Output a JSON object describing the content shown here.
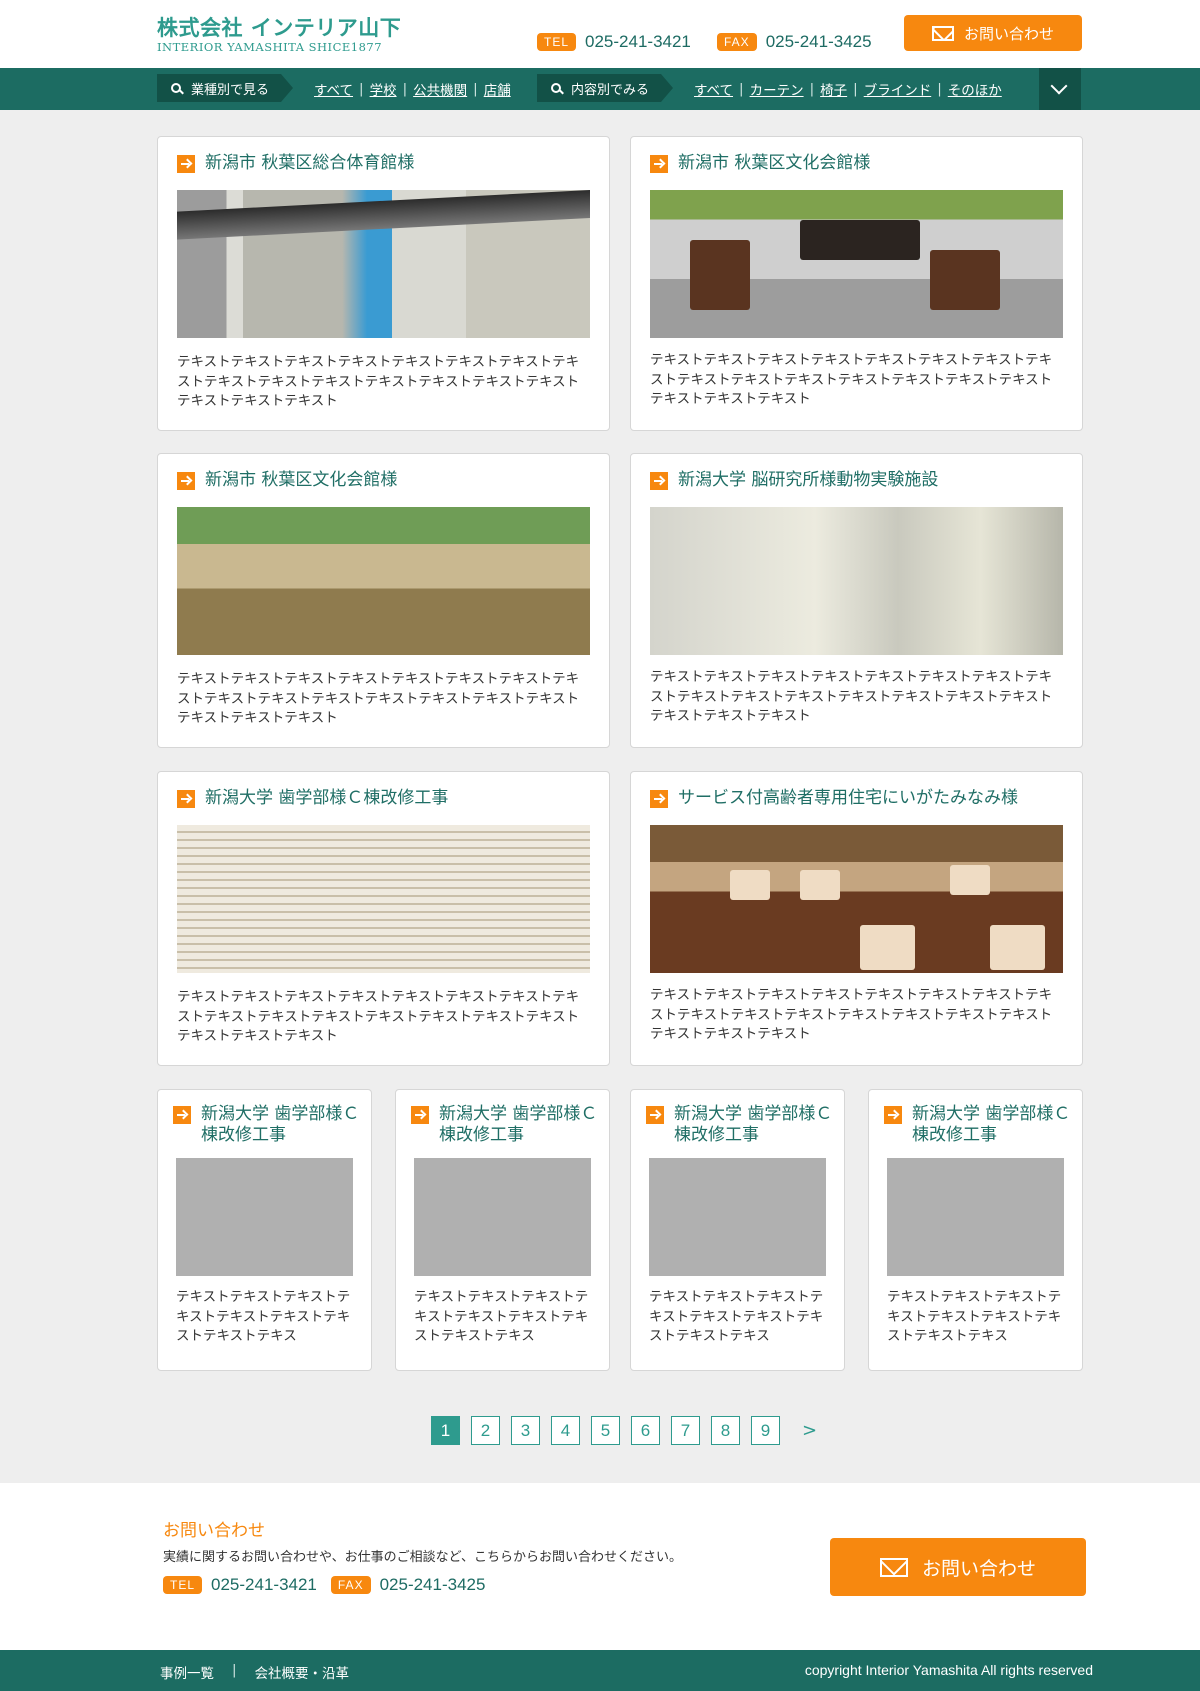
{
  "header": {
    "logo_main": "株式会社 インテリア山下",
    "logo_sub": "INTERIOR YAMASHITA SHICE1877",
    "tel_label": "TEL",
    "tel": "025-241-3421",
    "fax_label": "FAX",
    "fax": "025-241-3425",
    "contact_button": "お問い合わせ"
  },
  "nav": {
    "industry_label": "業種別で見る",
    "industry_links": [
      "すべて",
      "学校",
      "公共機関",
      "店舗"
    ],
    "content_label": "内容別でみる",
    "content_links": [
      "すべて",
      "カーテン",
      "椅子",
      "ブラインド",
      "そのほか"
    ],
    "toggle_icon": "chevron-down-icon"
  },
  "cases": [
    {
      "title": "新潟市 秋葉区総合体育館様",
      "text": "テキストテキストテキストテキストテキストテキストテキストテキストテキストテキストテキストテキストテキストテキストテキストテキストテキストテキスト"
    },
    {
      "title": "新潟市 秋葉区文化会館様",
      "text": "テキストテキストテキストテキストテキストテキストテキストテキストテキストテキストテキストテキストテキストテキストテキストテキストテキストテキスト"
    },
    {
      "title": "新潟市 秋葉区文化会館様",
      "text": "テキストテキストテキストテキストテキストテキストテキストテキストテキストテキストテキストテキストテキストテキストテキストテキストテキストテキスト"
    },
    {
      "title": "新潟大学 脳研究所様動物実験施設",
      "text": "テキストテキストテキストテキストテキストテキストテキストテキストテキストテキストテキストテキストテキストテキストテキストテキストテキストテキスト"
    },
    {
      "title": "新潟大学 歯学部様Ｃ棟改修工事",
      "text": "テキストテキストテキストテキストテキストテキストテキストテキストテキストテキストテキストテキストテキストテキストテキストテキストテキストテキスト"
    },
    {
      "title": "サービス付高齢者専用住宅にいがたみなみ様",
      "text": "テキストテキストテキストテキストテキストテキストテキストテキストテキストテキストテキストテキストテキストテキストテキストテキストテキストテキスト"
    }
  ],
  "small_cases": [
    {
      "title": "新潟大学 歯学部様Ｃ棟改修工事",
      "text": "テキストテキストテキストテキストテキストテキストテキストテキストテキス"
    },
    {
      "title": "新潟大学 歯学部様Ｃ棟改修工事",
      "text": "テキストテキストテキストテキストテキストテキストテキストテキストテキス"
    },
    {
      "title": "新潟大学 歯学部様Ｃ棟改修工事",
      "text": "テキストテキストテキストテキストテキストテキストテキストテキストテキス"
    },
    {
      "title": "新潟大学 歯学部様Ｃ棟改修工事",
      "text": "テキストテキストテキストテキストテキストテキストテキストテキストテキス"
    }
  ],
  "pagination": {
    "pages": [
      "1",
      "2",
      "3",
      "4",
      "5",
      "6",
      "7",
      "8",
      "9"
    ],
    "current": "1",
    "next": ">"
  },
  "contact": {
    "title": "お問い合わせ",
    "description": "実績に関するお問い合わせや、お仕事のご相談など、こちらからお問い合わせください。",
    "tel_label": "TEL",
    "tel": "025-241-3421",
    "fax_label": "FAX",
    "fax": "025-241-3425",
    "button": "お問い合わせ"
  },
  "footer": {
    "links": [
      "事例一覧",
      "会社概要・沿革"
    ],
    "separator": "|",
    "copyright": "copyright Interior Yamashita All rights reserved"
  },
  "colors": {
    "accent": "#f7880f",
    "teal": "#2e9b8e",
    "dark_teal": "#1c6c62"
  }
}
